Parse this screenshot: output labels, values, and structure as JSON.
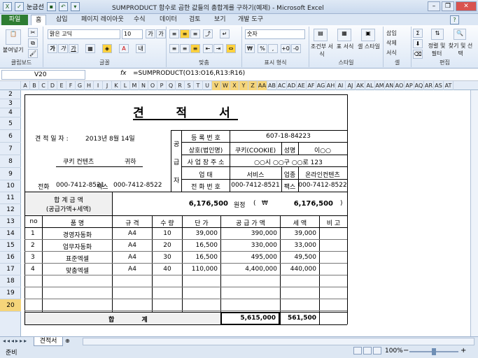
{
  "window": {
    "title": "SUMPRODUCT 함수로 곱한 값들의 총합계를 구하기(예제) - Microsoft Excel",
    "quick_access": [
      "눈금선"
    ]
  },
  "ribbon_tabs": [
    "파일",
    "홈",
    "삽입",
    "페이지 레이아웃",
    "수식",
    "데이터",
    "검토",
    "보기",
    "개발 도구"
  ],
  "ribbon": {
    "clipboard": {
      "label": "클립보드",
      "paste": "붙여넣기"
    },
    "font": {
      "label": "글꼴",
      "font_name": "맑은 고딕",
      "font_size": "10",
      "bold": "가",
      "italic": "가",
      "underline": "가",
      "grow": "가",
      "shrink": "가"
    },
    "alignment": {
      "label": "맞춤"
    },
    "number": {
      "label": "표시 형식",
      "format": "숫자",
      "percent": "%",
      "comma": ","
    },
    "styles": {
      "label": "스타일",
      "conditional": "조건부 서식",
      "table": "표 서식",
      "cell": "셀 스타일"
    },
    "cells": {
      "label": "셀",
      "insert": "삽입",
      "delete": "삭제",
      "format": "서식"
    },
    "editing": {
      "label": "편집",
      "sort": "정렬 및 필터",
      "find": "찾기 및 선택"
    }
  },
  "formula_bar": {
    "name_box": "V20",
    "fx": "fx",
    "formula": "=SUMPRODUCT(O13:O16,R13:R16)"
  },
  "columns": [
    "A",
    "B",
    "C",
    "D",
    "E",
    "F",
    "G",
    "H",
    "I",
    "J",
    "K",
    "L",
    "M",
    "N",
    "O",
    "P",
    "Q",
    "R",
    "S",
    "T",
    "U",
    "V",
    "W",
    "X",
    "Y",
    "Z",
    "AA",
    "AB",
    "AC",
    "AD",
    "AE",
    "AF",
    "AG",
    "AH",
    "AI",
    "AJ",
    "AK",
    "AL",
    "AM",
    "AN",
    "AO",
    "AP",
    "AQ",
    "AR",
    "AS",
    "AT"
  ],
  "selected_columns": [
    "V",
    "W",
    "X",
    "Y",
    "Z",
    "AA"
  ],
  "rows": [
    "2",
    "3",
    "4",
    "5",
    "6",
    "7",
    "8",
    "9",
    "10",
    "11",
    "12",
    "13",
    "14",
    "15",
    "16",
    "17",
    "18",
    "19",
    "20"
  ],
  "selected_row": "20",
  "doc": {
    "title": "견 적 서",
    "date_label": "견 적 일 자 :",
    "date_value": "2013년 8월 14일",
    "client": "쿠키 컨텐츠",
    "honorific": "귀하",
    "phone_label": "전화",
    "phone": "000-7412-8521",
    "fax_label": "팩스",
    "fax": "000-7412-8522",
    "supplier_side": [
      "공",
      "급",
      "자"
    ],
    "reg_label": "등 록 번 호",
    "reg_value": "607-18-84223",
    "name_label": "상호(법인명)",
    "name_value": "쿠키(COOKIE)",
    "ceo_label": "성명",
    "ceo_value": "이○○",
    "addr_label": "사 업 장 주 소",
    "addr_value": "○○시 ○○구 ○○로 123",
    "biz_label": "업 태",
    "biz_value": "서비스",
    "type_label": "업종",
    "type_value": "온라인컨텐츠",
    "tel_label": "전 화 번 호",
    "tel_value": "000-7412-8521",
    "fax2_label": "팩스",
    "fax2_value": "000-7412-8522",
    "total_label": "합 계 금 액",
    "total_sub": "(공급가액+세액)",
    "total_value": "6,176,500",
    "won_label": "원정",
    "paren_open": "(",
    "won_sign": "₩",
    "total_value2": "6,176,500",
    "paren_close": ")",
    "headers": [
      "no",
      "품 명",
      "규 격",
      "수 량",
      "단 가",
      "공 급 가 액",
      "세 액",
      "비 고"
    ],
    "items": [
      {
        "no": "1",
        "name": "경영자동화",
        "spec": "A4",
        "qty": "10",
        "price": "39,000",
        "supply": "390,000",
        "tax": "39,000"
      },
      {
        "no": "2",
        "name": "업무자동화",
        "spec": "A4",
        "qty": "20",
        "price": "16,500",
        "supply": "330,000",
        "tax": "33,000"
      },
      {
        "no": "3",
        "name": "표준엑셀",
        "spec": "A4",
        "qty": "30",
        "price": "16,500",
        "supply": "495,000",
        "tax": "49,500"
      },
      {
        "no": "4",
        "name": "맞춤엑셀",
        "spec": "A4",
        "qty": "40",
        "price": "110,000",
        "supply": "4,400,000",
        "tax": "440,000"
      }
    ],
    "sum_label": "합 계",
    "sum_supply": "5,615,000",
    "sum_tax": "561,500"
  },
  "status": {
    "ready": "준비",
    "sheet_tab": "견적서",
    "zoom": "100%",
    "zoom_minus": "−",
    "zoom_plus": "+"
  }
}
